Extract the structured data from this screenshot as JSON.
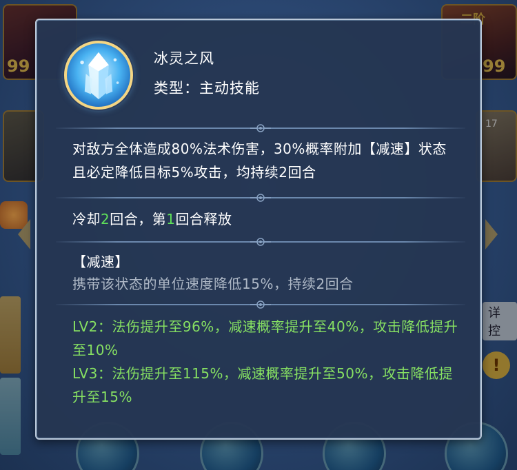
{
  "skill": {
    "name": "冰灵之风",
    "type_label": "类型：主动技能",
    "icon": "ice-crystal-icon",
    "description": "对敌方全体造成80%法术伤害，30%概率附加【减速】状态且必定降低目标5%攻击，均持续2回合",
    "cooldown": {
      "prefix": "冷却",
      "turns": "2",
      "middle": "回合，第",
      "release_turn": "1",
      "suffix": "回合释放"
    },
    "status": {
      "title": "【减速】",
      "description": "携带该状态的单位速度降低15%，持续2回合"
    },
    "upgrades": [
      {
        "text": "LV2：法伤提升至96%，减速概率提升至40%，攻击降低提升至10%"
      },
      {
        "text": "LV3：法伤提升至115%，减速概率提升至50%，攻击降低提升至15%"
      }
    ]
  },
  "background": {
    "top_left_level": "99",
    "top_right_level": "99",
    "top_right_tier": "二阶",
    "right_chip": "17",
    "right_label": "详控",
    "warning_mark": "!"
  },
  "colors": {
    "panel_bg": "#253652",
    "panel_border": "#b9c7d8",
    "text_primary": "#ffffff",
    "text_secondary": "#aeb8c6",
    "text_upgrade": "#86e062",
    "accent_number": "#5fe05a"
  }
}
